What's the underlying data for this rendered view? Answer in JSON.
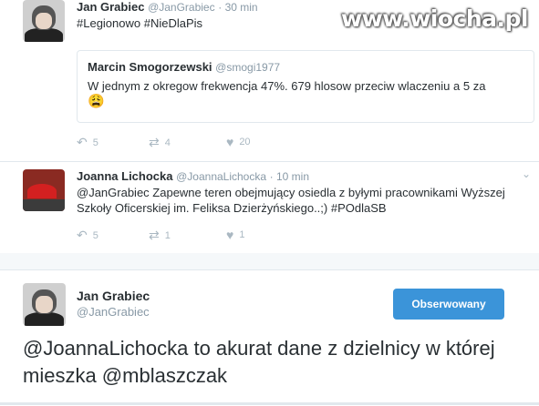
{
  "watermark": "www.wiocha.pl",
  "tweet1": {
    "name": "Jan Grabiec",
    "handle": "@JanGrabiec",
    "time": "· 30 min",
    "text": "#Legionowo #NieDlaPis",
    "quote": {
      "name": "Marcin Smogorzewski",
      "handle": "@smogi1977",
      "text": "W jednym z okregow frekwencja 47%. 679 hlosow przeciw wlaczeniu a 5 za",
      "emoji": "😩"
    },
    "replies": "5",
    "retweets": "4",
    "likes": "20"
  },
  "tweet2": {
    "name": "Joanna Lichocka",
    "handle": "@JoannaLichocka",
    "time": "· 10 min",
    "text_line1": "@JanGrabiec Zapewne teren obejmujący osiedla z byłymi pracownikami Wyższej",
    "text_line2": "Szkoły Oficerskiej im. Feliksa Dzierżyńskiego..;) #POdlaSB",
    "replies": "5",
    "retweets": "1",
    "likes": "1"
  },
  "tweet3": {
    "name": "Jan Grabiec",
    "handle": "@JanGrabiec",
    "follow_label": "Obserwowany",
    "text": "@JoannaLichocka to akurat dane z dzielnicy w której mieszka @mblaszczak"
  },
  "icons": {
    "reply": "reply-icon",
    "retweet": "retweet-icon",
    "like": "heart-icon",
    "more": "chevron-down-icon"
  },
  "colors": {
    "follow_button": "#3b94d9",
    "muted": "#8899a6"
  }
}
